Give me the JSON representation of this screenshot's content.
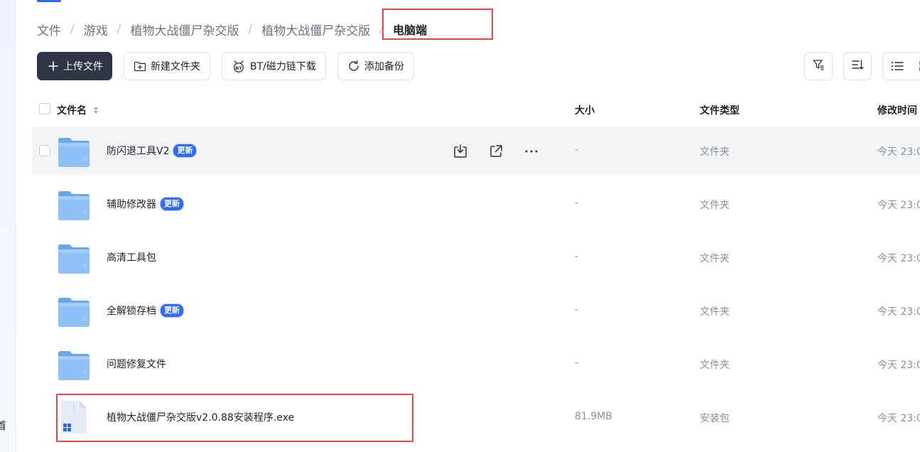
{
  "sidebar": {
    "cut_text": "首"
  },
  "breadcrumb": {
    "items": [
      "文件",
      "游戏",
      "植物大战僵尸杂交版",
      "植物大战僵尸杂交版"
    ],
    "current": "电脑端",
    "separator": "/"
  },
  "toolbar": {
    "upload": "上传文件",
    "new_folder": "新建文件夹",
    "bt_download": "BT/磁力链下载",
    "add_backup": "添加备份"
  },
  "table": {
    "headers": {
      "name": "文件名",
      "size": "大小",
      "type": "文件类型",
      "mtime": "修改时间"
    },
    "rows": [
      {
        "name": "防闪退工具V2",
        "badge": "更新",
        "size": "-",
        "type": "文件夹",
        "mtime": "今天 23:0",
        "icon": "folder-icon"
      },
      {
        "name": "辅助修改器",
        "badge": "更新",
        "size": "-",
        "type": "文件夹",
        "mtime": "今天 23:0",
        "icon": "folder-icon"
      },
      {
        "name": "高清工具包",
        "badge": "",
        "size": "-",
        "type": "文件夹",
        "mtime": "今天 23:0",
        "icon": "folder-icon"
      },
      {
        "name": "全解锁存档",
        "badge": "更新",
        "size": "-",
        "type": "文件夹",
        "mtime": "今天 23:0",
        "icon": "folder-icon"
      },
      {
        "name": "问题修复文件",
        "badge": "",
        "size": "-",
        "type": "文件夹",
        "mtime": "今天 23:0",
        "icon": "folder-icon"
      },
      {
        "name": "植物大战僵尸杂交版v2.0.88安装程序.exe",
        "badge": "",
        "size": "81.9MB",
        "type": "安装包",
        "mtime": "今天 23:0",
        "icon": "exe-file-icon"
      }
    ]
  },
  "colors": {
    "accent": "#2f6bff",
    "primary_button": "#2d3547",
    "highlight": "#e8484c",
    "folder": "#7db4f5"
  }
}
